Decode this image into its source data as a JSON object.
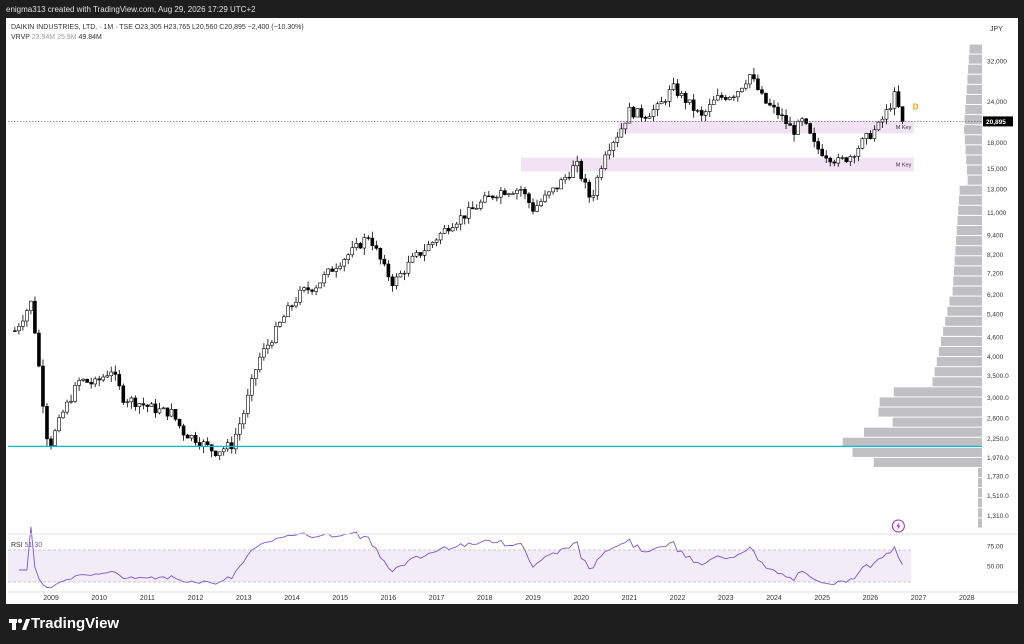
{
  "header": {
    "title": "enigma313 created with TradingView.com, Aug 29, 2026 17:29 UTC+2"
  },
  "legend": {
    "symbol": "DAIKIN INDUSTRIES, LTD. · 1M · TSE",
    "ohlc": "O23,305 H23,765 L20,560 C20,895 −2,400 (−10.30%)",
    "vrvp_label": "VRVP",
    "vrvp_v1": "23.94M",
    "vrvp_v2": "25.9M",
    "vrvp_v3": "49.84M"
  },
  "currency": "JPY",
  "brand": "TradingView",
  "chart_data": {
    "type": "candlestick",
    "y_scale": "log",
    "ylim": [
      1200,
      36000
    ],
    "y_ticks": [
      1310,
      1510,
      1730,
      1970,
      2250,
      2600,
      3000,
      3500,
      4000,
      4600,
      5400,
      6200,
      7200,
      8200,
      9400,
      11000,
      13000,
      15000,
      18000,
      24000,
      32000
    ],
    "y_tick_labels": [
      "1,310.0",
      "1,510.0",
      "1,730.0",
      "1,970.0",
      "2,250.0",
      "2,600.0",
      "3,000.0",
      "3,500.0",
      "4,000",
      "4,600",
      "5,400",
      "6,200",
      "7,200",
      "8,200",
      "9,400",
      "11,000",
      "13,000",
      "15,000",
      "18,000",
      "24,000",
      "32,000"
    ],
    "x_ticks": [
      "2009",
      "2010",
      "2011",
      "2012",
      "2013",
      "2014",
      "2015",
      "2016",
      "2017",
      "2018",
      "2019",
      "2020",
      "2021",
      "2022",
      "2023",
      "2024",
      "2025",
      "2026",
      "2027",
      "2028"
    ],
    "x_start_year": 2008.25,
    "last_price": {
      "value": 20895,
      "label": "20,895"
    },
    "horizontal_line": {
      "value": 2130,
      "color": "#00bcd4"
    },
    "zones": [
      {
        "label": "M Key",
        "low": 19200,
        "high": 21000,
        "from": 2020.75,
        "to": 2026.9
      },
      {
        "label": "M Key",
        "low": 14700,
        "high": 16200,
        "from": 2018.75,
        "to": 2026.9
      }
    ],
    "marker_label": "D",
    "series_anchors": [
      [
        2008.25,
        4800
      ],
      [
        2008.6,
        5900
      ],
      [
        2008.8,
        3200
      ],
      [
        2008.95,
        2100
      ],
      [
        2009.25,
        2700
      ],
      [
        2009.6,
        3400
      ],
      [
        2009.9,
        3300
      ],
      [
        2010.25,
        3650
      ],
      [
        2010.5,
        3000
      ],
      [
        2010.8,
        2900
      ],
      [
        2011.2,
        2750
      ],
      [
        2011.5,
        2700
      ],
      [
        2011.75,
        2350
      ],
      [
        2012.0,
        2250
      ],
      [
        2012.4,
        2050
      ],
      [
        2012.75,
        2150
      ],
      [
        2013.0,
        2700
      ],
      [
        2013.3,
        3900
      ],
      [
        2013.6,
        4600
      ],
      [
        2013.9,
        5500
      ],
      [
        2014.2,
        6300
      ],
      [
        2014.5,
        6600
      ],
      [
        2014.9,
        7600
      ],
      [
        2015.3,
        8500
      ],
      [
        2015.6,
        9400
      ],
      [
        2015.9,
        7500
      ],
      [
        2016.1,
        6700
      ],
      [
        2016.5,
        7900
      ],
      [
        2016.9,
        8900
      ],
      [
        2017.3,
        10200
      ],
      [
        2017.7,
        11100
      ],
      [
        2018.0,
        12000
      ],
      [
        2018.3,
        12800
      ],
      [
        2018.75,
        13000
      ],
      [
        2019.0,
        11300
      ],
      [
        2019.5,
        13200
      ],
      [
        2019.9,
        15500
      ],
      [
        2020.2,
        12000
      ],
      [
        2020.5,
        17000
      ],
      [
        2020.8,
        19500
      ],
      [
        2021.0,
        22500
      ],
      [
        2021.3,
        21800
      ],
      [
        2021.6,
        23000
      ],
      [
        2021.9,
        26500
      ],
      [
        2022.2,
        24000
      ],
      [
        2022.5,
        21500
      ],
      [
        2022.8,
        24500
      ],
      [
        2023.2,
        25500
      ],
      [
        2023.5,
        29000
      ],
      [
        2023.8,
        24000
      ],
      [
        2024.1,
        22000
      ],
      [
        2024.4,
        19500
      ],
      [
        2024.6,
        21000
      ],
      [
        2024.85,
        17500
      ],
      [
        2025.1,
        16500
      ],
      [
        2025.35,
        15700
      ],
      [
        2025.6,
        16500
      ],
      [
        2025.9,
        18500
      ],
      [
        2026.15,
        20000
      ],
      [
        2026.35,
        22500
      ],
      [
        2026.5,
        25000
      ],
      [
        2026.67,
        20895
      ]
    ],
    "volume_profile": {
      "label": "VRVP"
    },
    "rsi": {
      "label": "RSI",
      "value": "51.30",
      "levels": [
        70,
        30
      ],
      "tick_labels": [
        "75.00",
        "50.00"
      ]
    }
  }
}
